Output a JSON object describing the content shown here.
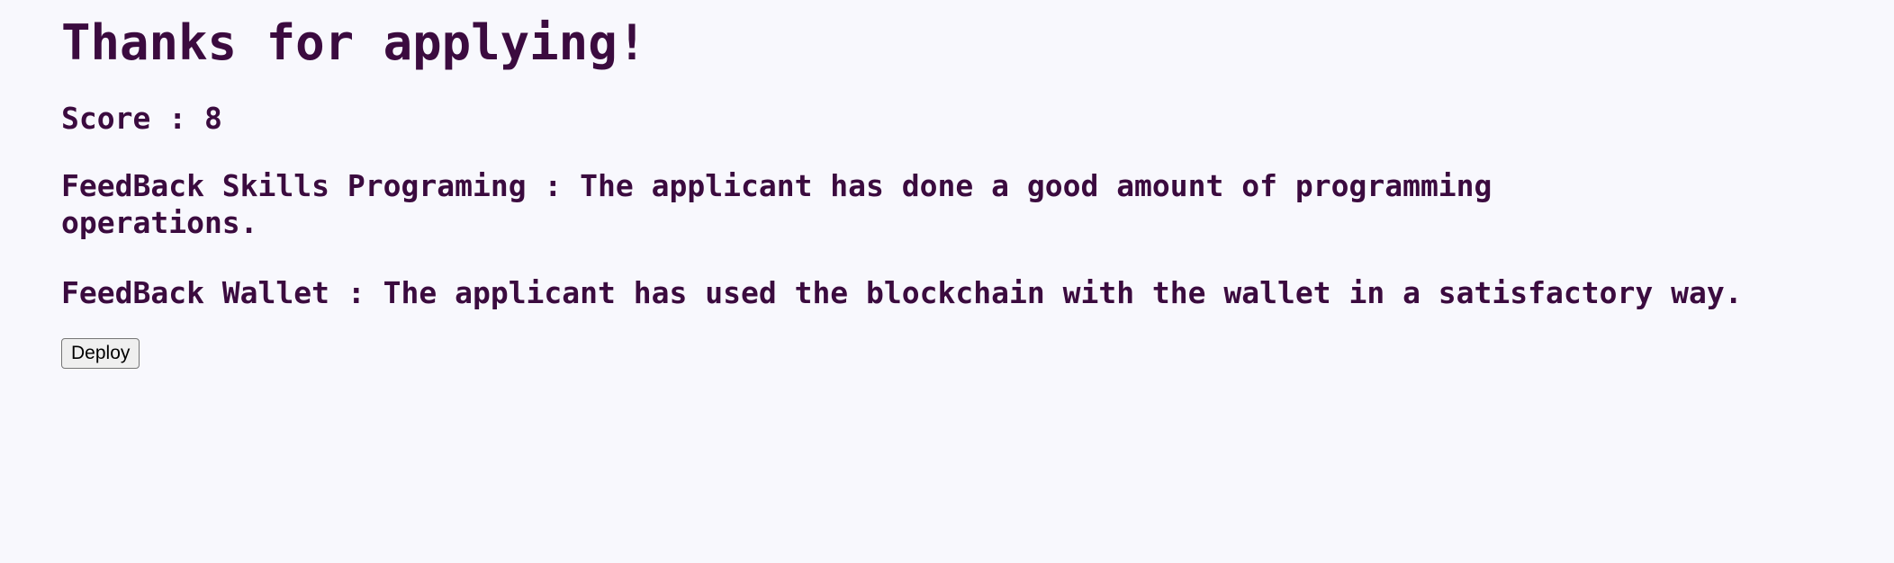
{
  "page": {
    "background_color": "#f8f8fd",
    "text_color": "#3b0b3f",
    "heading": "Thanks for applying!",
    "score_line": "Score : 8",
    "feedback": [
      {
        "id": "skills-programing",
        "text": "FeedBack Skills Programing : The applicant has done a good amount of programming operations."
      },
      {
        "id": "wallet",
        "text": "FeedBack Wallet : The applicant has used the blockchain with the wallet in a satisfactory way."
      }
    ],
    "actions": {
      "deploy_label": "Deploy"
    }
  }
}
